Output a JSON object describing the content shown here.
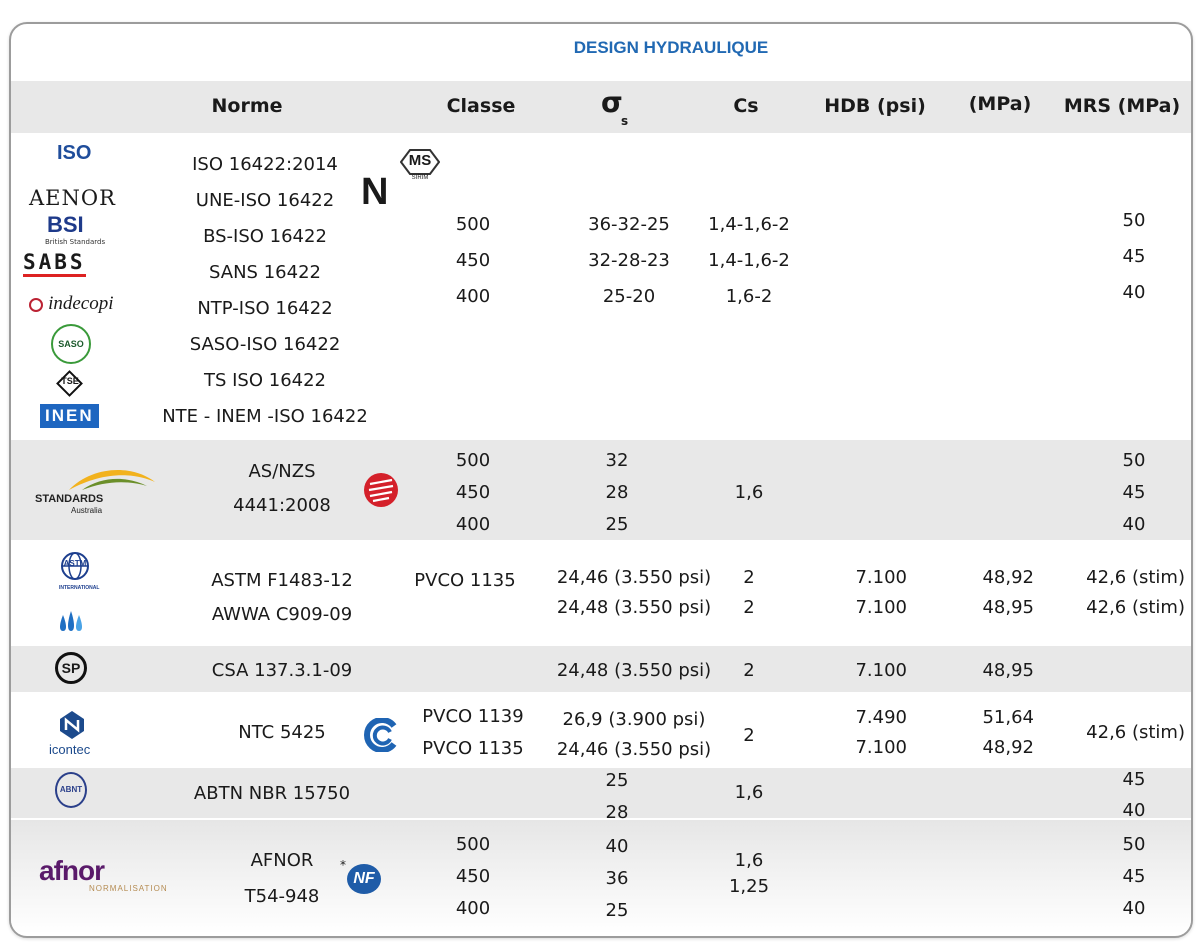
{
  "title": "DESIGN HYDRAULIQUE",
  "columns": {
    "norme": "Norme",
    "classe": "Classe",
    "sigma": "σ",
    "sigma_sub": "s",
    "cs": "Cs",
    "hdb": "HDB (psi)",
    "mpa": "(MPa)",
    "mrs": "MRS (MPa)"
  },
  "logos": {
    "iso": "ISO",
    "aenor": "AENOR",
    "bsi": "BSI",
    "bsi_sub": "British Standards",
    "sabs": "SABS",
    "indecopi": "indecopi",
    "saso": "SASO",
    "tse": "TSE",
    "inen": "INEN",
    "ms": "MS",
    "ms_sub": "SIRIM",
    "n_mark": "N",
    "standards": "STANDARDS",
    "standards_sub": "Australia",
    "astm": "ASTM",
    "astm_sub": "INTERNATIONAL",
    "csa": "SP",
    "icontec": "icontec",
    "abnt": "ABNT",
    "afnor": "afnor",
    "afnor_sub": "NORMALISATION",
    "nf": "NF"
  },
  "group1": {
    "norms": [
      "ISO 16422:2014",
      "UNE-ISO 16422",
      "BS-ISO 16422",
      "SANS 16422",
      "NTP-ISO 16422",
      "SASO-ISO 16422",
      "TS ISO 16422",
      "NTE - INEM -ISO 16422"
    ],
    "classe": [
      "500",
      "450",
      "400"
    ],
    "sigma": [
      "36-32-25",
      "32-28-23",
      "25-20"
    ],
    "cs": [
      "1,4-1,6-2",
      "1,4-1,6-2",
      "1,6-2"
    ],
    "mrs": [
      "50",
      "45",
      "40"
    ]
  },
  "group2": {
    "norms": [
      "AS/NZS",
      "4441:2008"
    ],
    "classe": [
      "500",
      "450",
      "400"
    ],
    "sigma": [
      "32",
      "28",
      "25"
    ],
    "cs": "1,6",
    "mrs": [
      "50",
      "45",
      "40"
    ]
  },
  "group3": {
    "norms": [
      "ASTM F1483-12",
      "AWWA C909-09"
    ],
    "classe": "PVCO 1135",
    "sigma": [
      "24,46 (3.550 psi)",
      "24,48 (3.550 psi)"
    ],
    "cs": [
      "2",
      "2"
    ],
    "hdb": [
      "7.100",
      "7.100"
    ],
    "mpa": [
      "48,92",
      "48,95"
    ],
    "mrs": [
      "42,6 (stim)",
      "42,6 (stim)"
    ]
  },
  "group4": {
    "norm": "CSA 137.3.1-09",
    "sigma": "24,48 (3.550 psi)",
    "cs": "2",
    "hdb": "7.100",
    "mpa": "48,95"
  },
  "group5": {
    "norm": "NTC 5425",
    "classe": [
      "PVCO 1139",
      "PVCO 1135"
    ],
    "sigma": [
      "26,9 (3.900 psi)",
      "24,46 (3.550 psi)"
    ],
    "cs": "2",
    "hdb": [
      "7.490",
      "7.100"
    ],
    "mpa": [
      "51,64",
      "48,92"
    ],
    "mrs": "42,6 (stim)"
  },
  "group6": {
    "norm": "ABTN NBR 15750",
    "sigma": [
      "25",
      "28"
    ],
    "cs": "1,6",
    "mrs": [
      "45",
      "40"
    ]
  },
  "group7": {
    "norms": [
      "AFNOR",
      "T54-948"
    ],
    "classe": [
      "500",
      "450",
      "400"
    ],
    "sigma": [
      "40",
      "36",
      "25"
    ],
    "cs": [
      "1,6",
      "1,25"
    ],
    "mrs": [
      "50",
      "45",
      "40"
    ]
  },
  "colors": {
    "title_blue": "#2169b3",
    "band_grey": "#e8e8e8",
    "border": "#9c9c9c"
  }
}
